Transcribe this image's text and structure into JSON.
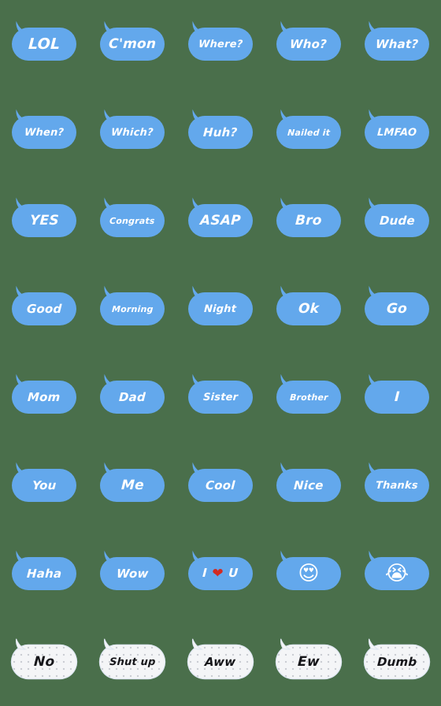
{
  "sheet": {
    "title": "Speech Bubble Word Stickers",
    "background_color": "#4a6f4b",
    "columns": 5,
    "rows": 8,
    "bubble_blue_color": "#63a8ec",
    "bubble_white_color": "#f4f5f7",
    "text_light_color": "#ffffff",
    "text_dark_color": "#16161a",
    "heart_color": "#d32a22"
  },
  "stickers": [
    {
      "id": "lol",
      "label": "LOL",
      "style": "blue",
      "size": "xl"
    },
    {
      "id": "cmon",
      "label": "C'mon",
      "style": "blue",
      "size": "lg"
    },
    {
      "id": "where",
      "label": "Where?",
      "style": "blue",
      "size": "sm"
    },
    {
      "id": "who",
      "label": "Who?",
      "style": "blue",
      "size": "md"
    },
    {
      "id": "what",
      "label": "What?",
      "style": "blue",
      "size": "md"
    },
    {
      "id": "when",
      "label": "When?",
      "style": "blue",
      "size": "sm"
    },
    {
      "id": "which",
      "label": "Which?",
      "style": "blue",
      "size": "sm"
    },
    {
      "id": "huh",
      "label": "Huh?",
      "style": "blue",
      "size": "md"
    },
    {
      "id": "nailed-it",
      "label": "Nailed it",
      "style": "blue",
      "size": "xs"
    },
    {
      "id": "lmfao",
      "label": "LMFAO",
      "style": "blue",
      "size": "sm"
    },
    {
      "id": "yes",
      "label": "YES",
      "style": "blue",
      "size": "lg"
    },
    {
      "id": "congrats",
      "label": "Congrats",
      "style": "blue",
      "size": "xs"
    },
    {
      "id": "asap",
      "label": "ASAP",
      "style": "blue",
      "size": "lg"
    },
    {
      "id": "bro",
      "label": "Bro",
      "style": "blue",
      "size": "lg"
    },
    {
      "id": "dude",
      "label": "Dude",
      "style": "blue",
      "size": "md"
    },
    {
      "id": "good",
      "label": "Good",
      "style": "blue",
      "size": "md"
    },
    {
      "id": "morning",
      "label": "Morning",
      "style": "blue",
      "size": "xs"
    },
    {
      "id": "night",
      "label": "Night",
      "style": "blue",
      "size": "sm"
    },
    {
      "id": "ok",
      "label": "Ok",
      "style": "blue",
      "size": "lg"
    },
    {
      "id": "go",
      "label": "Go",
      "style": "blue",
      "size": "lg"
    },
    {
      "id": "mom",
      "label": "Mom",
      "style": "blue",
      "size": "md"
    },
    {
      "id": "dad",
      "label": "Dad",
      "style": "blue",
      "size": "md"
    },
    {
      "id": "sister",
      "label": "Sister",
      "style": "blue",
      "size": "sm"
    },
    {
      "id": "brother",
      "label": "Brother",
      "style": "blue",
      "size": "xs"
    },
    {
      "id": "i",
      "label": "I",
      "style": "blue",
      "size": "lg"
    },
    {
      "id": "you",
      "label": "You",
      "style": "blue",
      "size": "md"
    },
    {
      "id": "me",
      "label": "Me",
      "style": "blue",
      "size": "lg"
    },
    {
      "id": "cool",
      "label": "Cool",
      "style": "blue",
      "size": "md"
    },
    {
      "id": "nice",
      "label": "Nice",
      "style": "blue",
      "size": "md"
    },
    {
      "id": "thanks",
      "label": "Thanks",
      "style": "blue",
      "size": "sm"
    },
    {
      "id": "haha",
      "label": "Haha",
      "style": "blue",
      "size": "md"
    },
    {
      "id": "wow",
      "label": "Wow",
      "style": "blue",
      "size": "md"
    },
    {
      "id": "i-love-u",
      "label": "I ❤ U",
      "style": "blue",
      "size": "md",
      "kind": "love"
    },
    {
      "id": "heart-eyes-emoji",
      "label": "😍",
      "style": "blue",
      "size": "md",
      "kind": "emoji"
    },
    {
      "id": "loudly-crying-emoji",
      "label": "😭",
      "style": "blue",
      "size": "md",
      "kind": "emoji"
    },
    {
      "id": "no",
      "label": "No",
      "style": "white",
      "size": "lg"
    },
    {
      "id": "shut-up",
      "label": "Shut up",
      "style": "white",
      "size": "sm"
    },
    {
      "id": "aww",
      "label": "Aww",
      "style": "white",
      "size": "md"
    },
    {
      "id": "ew",
      "label": "Ew",
      "style": "white",
      "size": "lg"
    },
    {
      "id": "dumb",
      "label": "Dumb",
      "style": "white",
      "size": "md"
    }
  ]
}
